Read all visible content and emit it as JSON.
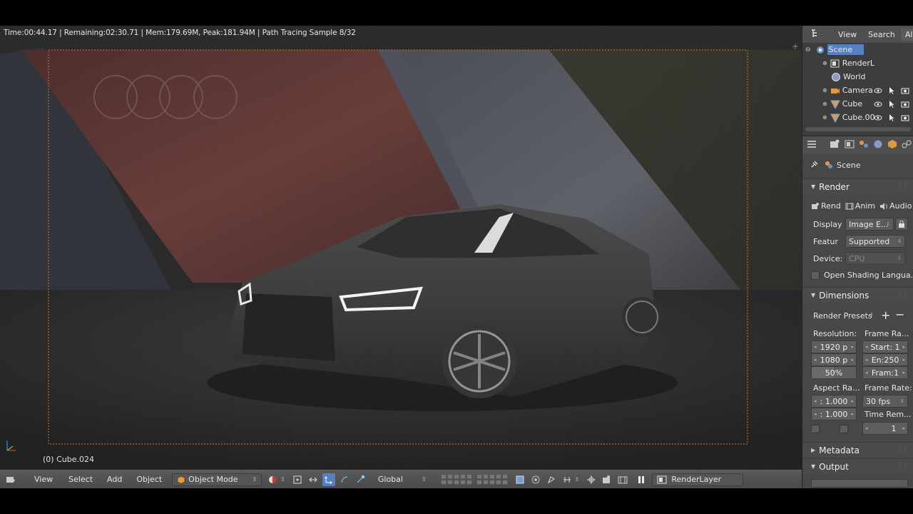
{
  "viewport": {
    "stats": "Time:00:44.17 | Remaining:02:30.71 | Mem:179.69M, Peak:181.94M | Path Tracing Sample 8/32",
    "object_label": "(0) Cube.024"
  },
  "header": {
    "view": "View",
    "select": "Select",
    "add": "Add",
    "object": "Object",
    "mode": "Object Mode",
    "orientation": "Global",
    "render_layer": "RenderLayer"
  },
  "outliner": {
    "tabs": [
      "View",
      "Search",
      "All"
    ],
    "rows": [
      {
        "label": "Scene",
        "icon": "scene-icon",
        "selected": true
      },
      {
        "label": "RenderL",
        "icon": "render-layers-icon"
      },
      {
        "label": "World",
        "icon": "world-icon"
      },
      {
        "label": "Camera",
        "icon": "camera-icon"
      },
      {
        "label": "Cube",
        "icon": "mesh-icon"
      },
      {
        "label": "Cube.00",
        "icon": "mesh-icon"
      }
    ]
  },
  "properties": {
    "context": "Scene",
    "render_panel": {
      "title": "Render",
      "buttons": [
        "Rend",
        "Anim",
        "Audio"
      ],
      "display_label": "Display",
      "display_value": "Image E...",
      "feature_label": "Featur",
      "feature_value": "Supported",
      "device_label": "Device:",
      "device_value": "CPU",
      "osl_label": "Open Shading Langua..."
    },
    "dimensions_panel": {
      "title": "Dimensions",
      "presets": "Render Presets",
      "resolution_label": "Resolution:",
      "res_x": "1920 p",
      "res_y": "1080 p",
      "res_pct": "50%",
      "frame_range_label": "Frame Ra...",
      "start": "Start: 1",
      "end": "En:250",
      "frame_step": "Fram:1",
      "aspect_label": "Aspect Ra...",
      "aspect_x": ": 1.000",
      "aspect_y": ": 1.000",
      "frame_rate_label": "Frame Rate:",
      "fps": "30 fps",
      "time_remap_label": "Time Rem...",
      "time_remap_value": "1"
    },
    "metadata_title": "Metadata",
    "output_title": "Output"
  },
  "colors": {
    "selection": "#5680c2",
    "panel_bg": "#474747",
    "header_bg": "#4f4f4f"
  }
}
